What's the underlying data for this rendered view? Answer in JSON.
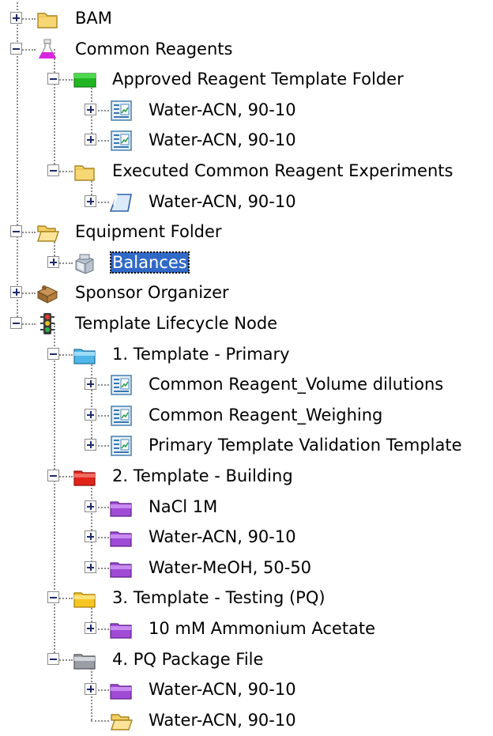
{
  "tree": {
    "nodes": [
      {
        "label": "BAM",
        "icon": "folder-closed-icon",
        "expand": "plus"
      },
      {
        "label": "Common Reagents",
        "icon": "flask-icon",
        "expand": "minus"
      },
      {
        "label": "Approved Reagent Template Folder",
        "icon": "green-folder-icon",
        "expand": "minus"
      },
      {
        "label": "Water-ACN, 90-10",
        "icon": "template-icon",
        "expand": "plus"
      },
      {
        "label": "Water-ACN, 90-10",
        "icon": "template-icon",
        "expand": "plus"
      },
      {
        "label": "Executed Common Reagent Experiments",
        "icon": "folder-closed-icon",
        "expand": "minus"
      },
      {
        "label": "Water-ACN, 90-10",
        "icon": "experiment-icon",
        "expand": "plus"
      },
      {
        "label": "Equipment Folder",
        "icon": "folder-open-icon",
        "expand": "minus"
      },
      {
        "label": "Balances",
        "icon": "balance-icon",
        "expand": "plus",
        "selected": true
      },
      {
        "label": "Sponsor Organizer",
        "icon": "sponsor-organizer-icon",
        "expand": "plus"
      },
      {
        "label": "Template Lifecycle Node",
        "icon": "traffic-light-icon",
        "expand": "minus"
      },
      {
        "label": "1. Template - Primary",
        "icon": "blue-folder-icon",
        "expand": "minus"
      },
      {
        "label": "Common Reagent_Volume dilutions",
        "icon": "template-icon",
        "expand": "plus"
      },
      {
        "label": "Common Reagent_Weighing",
        "icon": "template-icon",
        "expand": "plus"
      },
      {
        "label": "Primary Template Validation Template",
        "icon": "template-icon",
        "expand": "plus"
      },
      {
        "label": "2. Template - Building",
        "icon": "red-folder-icon",
        "expand": "minus"
      },
      {
        "label": "NaCl 1M",
        "icon": "purple-folder-icon",
        "expand": "plus"
      },
      {
        "label": "Water-ACN, 90-10",
        "icon": "purple-folder-icon",
        "expand": "plus"
      },
      {
        "label": "Water-MeOH, 50-50",
        "icon": "purple-folder-icon",
        "expand": "plus"
      },
      {
        "label": "3. Template - Testing (PQ)",
        "icon": "yellow-folder-icon",
        "expand": "minus"
      },
      {
        "label": "10 mM Ammonium Acetate",
        "icon": "purple-folder-icon",
        "expand": "plus"
      },
      {
        "label": "4. PQ Package File",
        "icon": "gray-folder-icon",
        "expand": "minus"
      },
      {
        "label": "Water-ACN, 90-10",
        "icon": "purple-folder-icon",
        "expand": "plus"
      },
      {
        "label": "Water-ACN, 90-10",
        "icon": "folder-open-icon",
        "expand": ""
      }
    ]
  }
}
